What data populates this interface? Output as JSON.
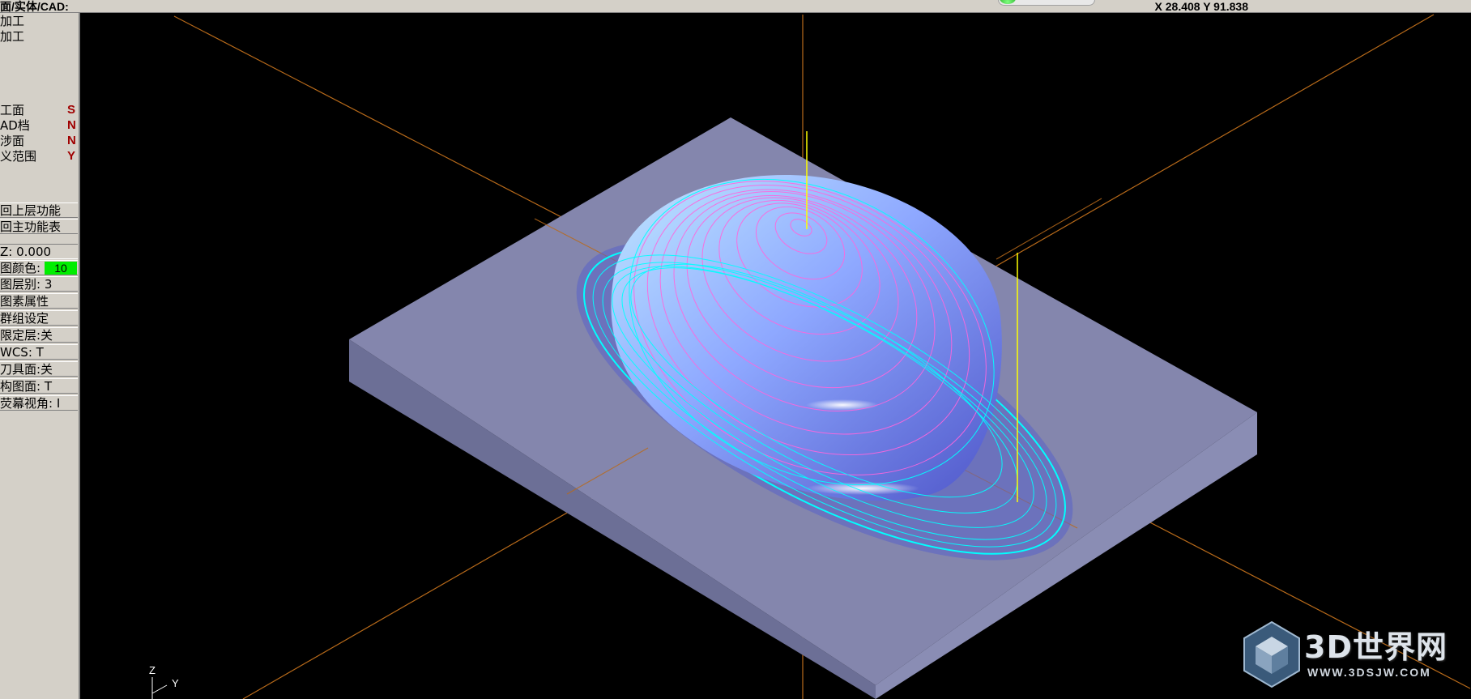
{
  "app": {
    "title": "面/实体/CAD:",
    "coords": "X 28.408  Y 91.838"
  },
  "sidebar": {
    "items": [
      {
        "label": "加工",
        "flag": ""
      },
      {
        "label": "加工",
        "flag": ""
      },
      {
        "label": "工面",
        "flag": "S"
      },
      {
        "label": "AD档",
        "flag": "N"
      },
      {
        "label": "涉面",
        "flag": "N"
      },
      {
        "label": "义范围",
        "flag": "Y"
      }
    ],
    "nav_buttons": [
      {
        "label": "回上层功能"
      },
      {
        "label": "回主功能表"
      }
    ],
    "z_label": "Z:  0.000",
    "color_label": "图颜色:",
    "color_value": "10",
    "status_buttons": [
      {
        "label": "图层别: 3"
      },
      {
        "label": "图素属性"
      },
      {
        "label": "群组设定"
      },
      {
        "label": "限定层:关"
      },
      {
        "label": "WCS:  T"
      },
      {
        "label": "刀具面:关"
      },
      {
        "label": "构图面: T"
      },
      {
        "label": "荧幕视角: I"
      }
    ]
  },
  "triad": {
    "z": "Z",
    "y": "Y"
  },
  "watermark": {
    "brand": "3D世界网",
    "url": "WWW.3DSJW.COM"
  },
  "colors": {
    "ui_gray": "#d4d0c8",
    "background": "#000000",
    "axis": "#b86a1a",
    "stock_top": "#8486ad",
    "toolpath": "#00ffff",
    "toolpath_contour": "#ff66dd",
    "tool_marker": "#ffff00",
    "layer_color": "#00ee00"
  }
}
